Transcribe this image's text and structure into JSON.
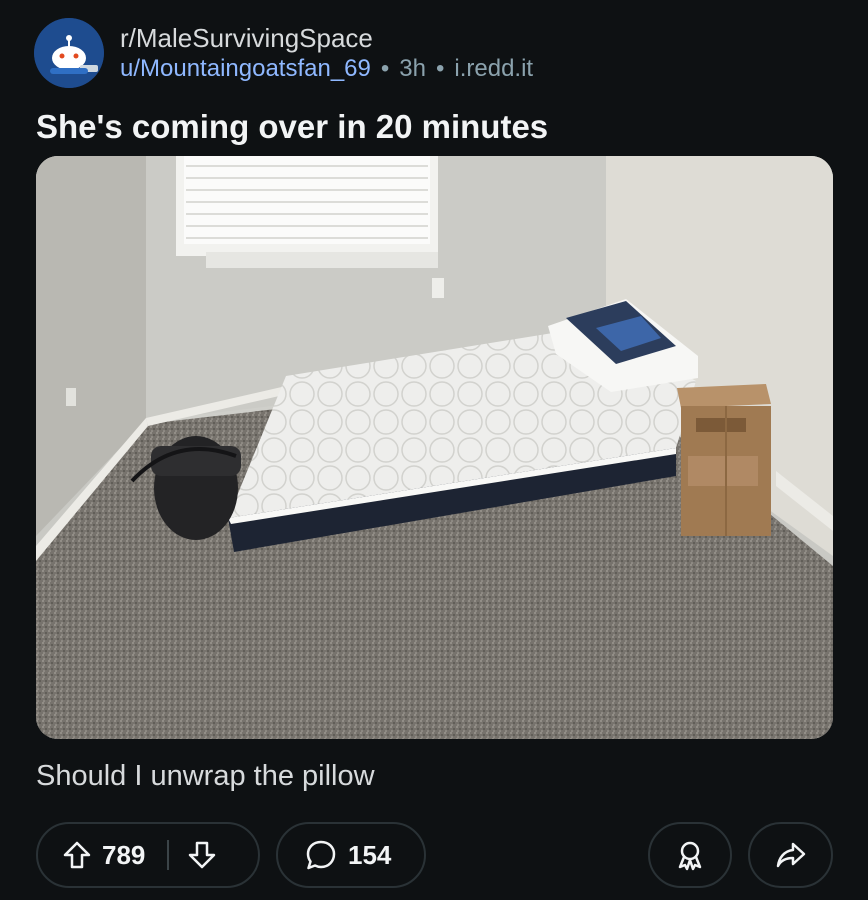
{
  "post": {
    "subreddit": "r/MaleSurvivingSpace",
    "author": "u/Mountaingoatsfan_69",
    "separator": "•",
    "age": "3h",
    "domain": "i.redd.it",
    "title": "She's coming over in 20 minutes",
    "body": "Should I unwrap the pillow",
    "image_alt": "Bare bedroom with a mattress on the carpeted floor, a wrapped pillow, a duffel bag and a cardboard box"
  },
  "actions": {
    "upvotes": "789",
    "comments": "154"
  },
  "icons": {
    "avatar": "subreddit-snoo-avatar",
    "upvote": "arrow-up-icon",
    "downvote": "arrow-down-icon",
    "comment": "speech-bubble-icon",
    "award": "award-ribbon-icon",
    "share": "share-arrow-icon"
  },
  "colors": {
    "background": "#0e1113",
    "author_link": "#8fb8ff",
    "meta_text": "#8ba2ad",
    "pill_border": "#2a3236"
  }
}
